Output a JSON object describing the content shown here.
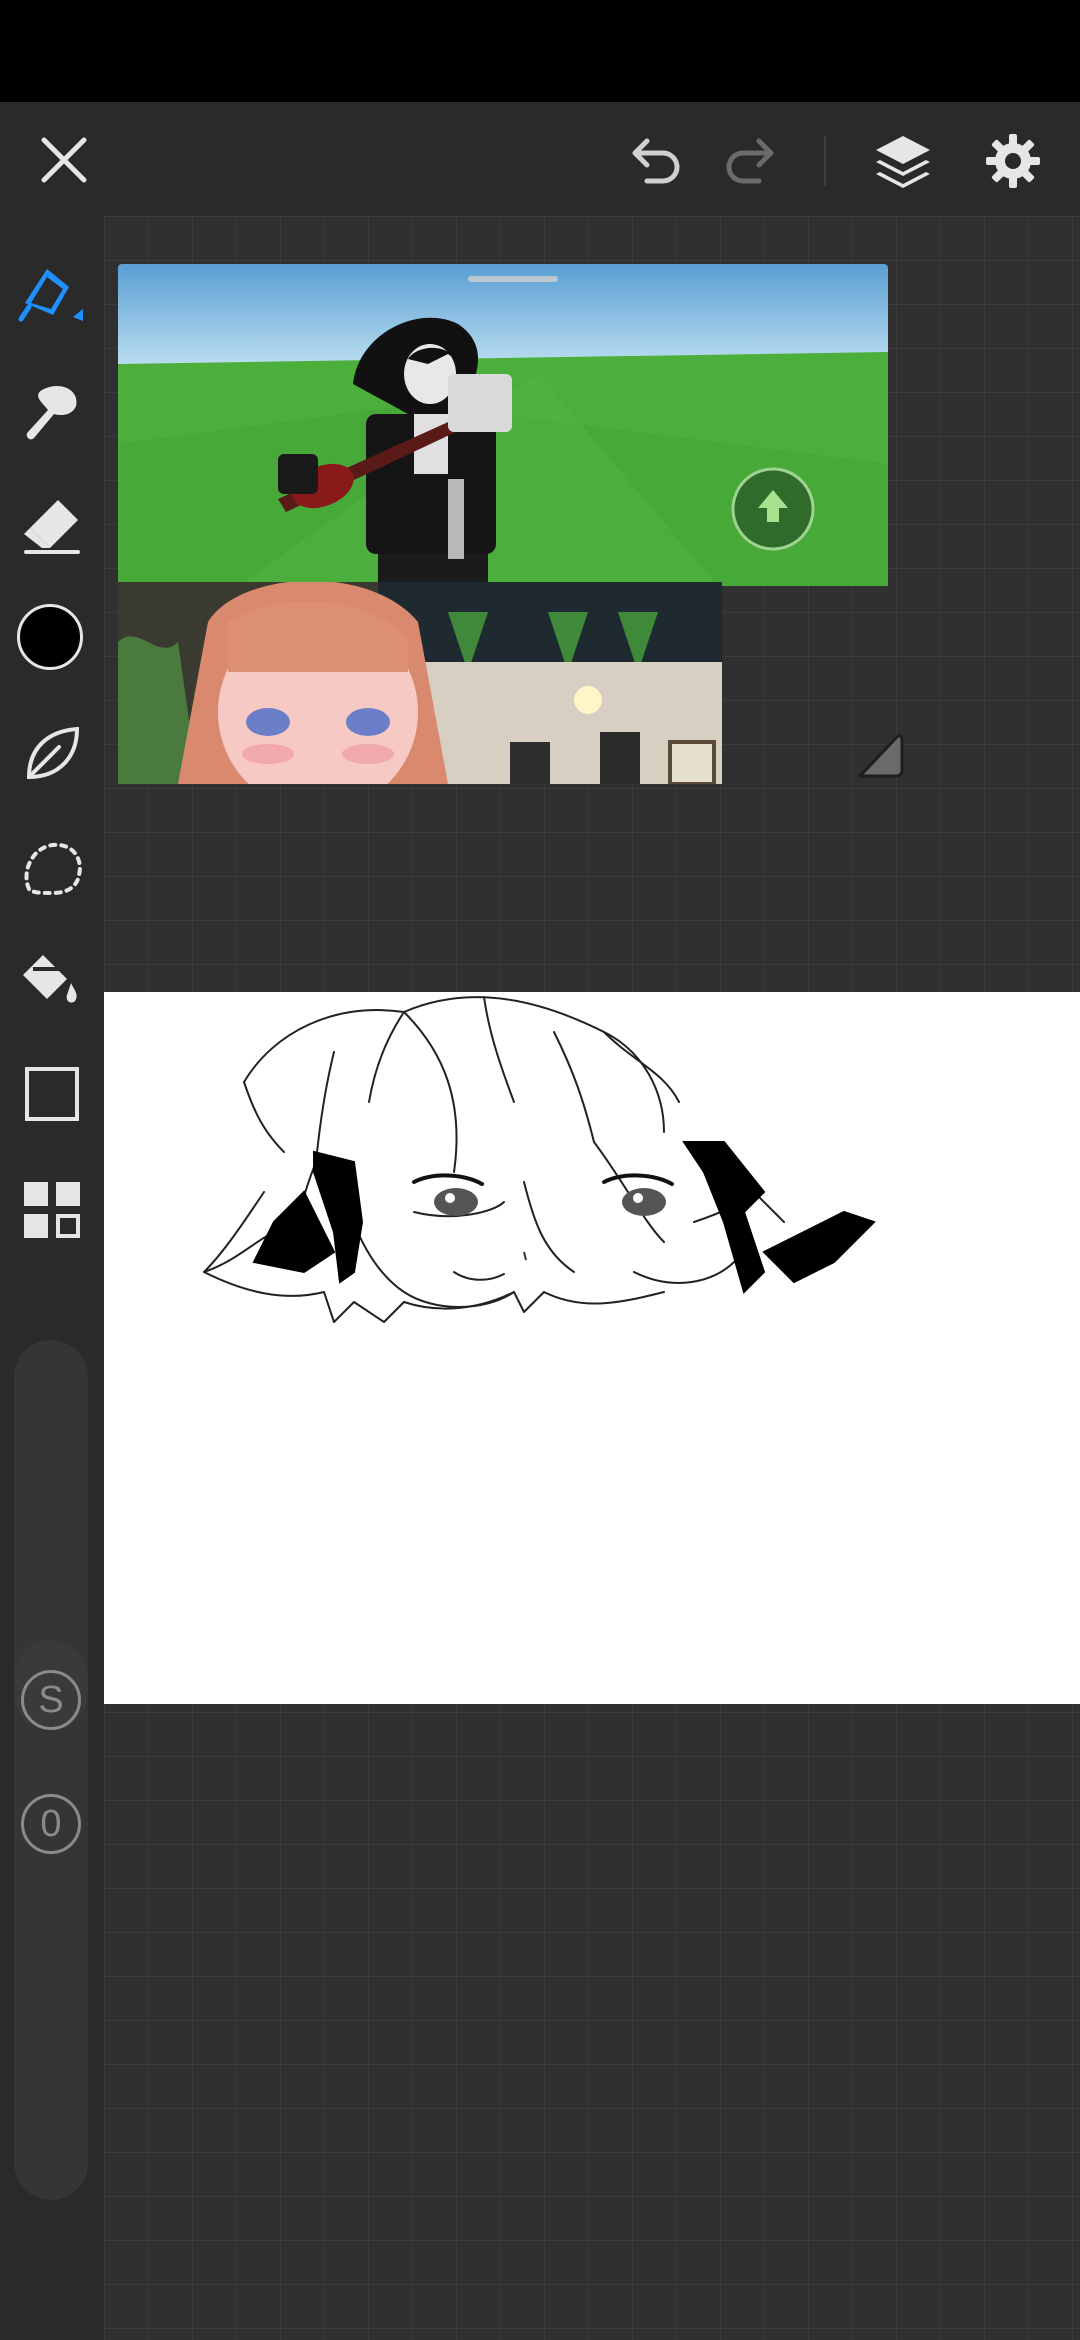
{
  "toolbar": {
    "close_icon": "close-icon",
    "undo_icon": "undo-icon",
    "redo_icon": "redo-icon",
    "layers_icon": "layers-icon",
    "settings_icon": "gear-icon"
  },
  "tools": [
    {
      "name": "pen",
      "icon": "pen-icon",
      "selected": true
    },
    {
      "name": "brush",
      "icon": "brush-icon"
    },
    {
      "name": "eraser",
      "icon": "eraser-icon"
    },
    {
      "name": "color",
      "icon": "color-swatch",
      "value": "#000000"
    },
    {
      "name": "smudge",
      "icon": "leaf-icon"
    },
    {
      "name": "lasso",
      "icon": "lasso-icon"
    },
    {
      "name": "fill",
      "icon": "paint-bucket-icon"
    },
    {
      "name": "shape",
      "icon": "square-icon"
    },
    {
      "name": "more",
      "icon": "grid-icon"
    }
  ],
  "slider": {
    "size_label": "S",
    "opacity_label": "0"
  },
  "colors": {
    "accent": "#1e90ff",
    "background": "#2f2f2f",
    "toolbar": "#2a2a2a",
    "canvas": "#ffffff"
  }
}
